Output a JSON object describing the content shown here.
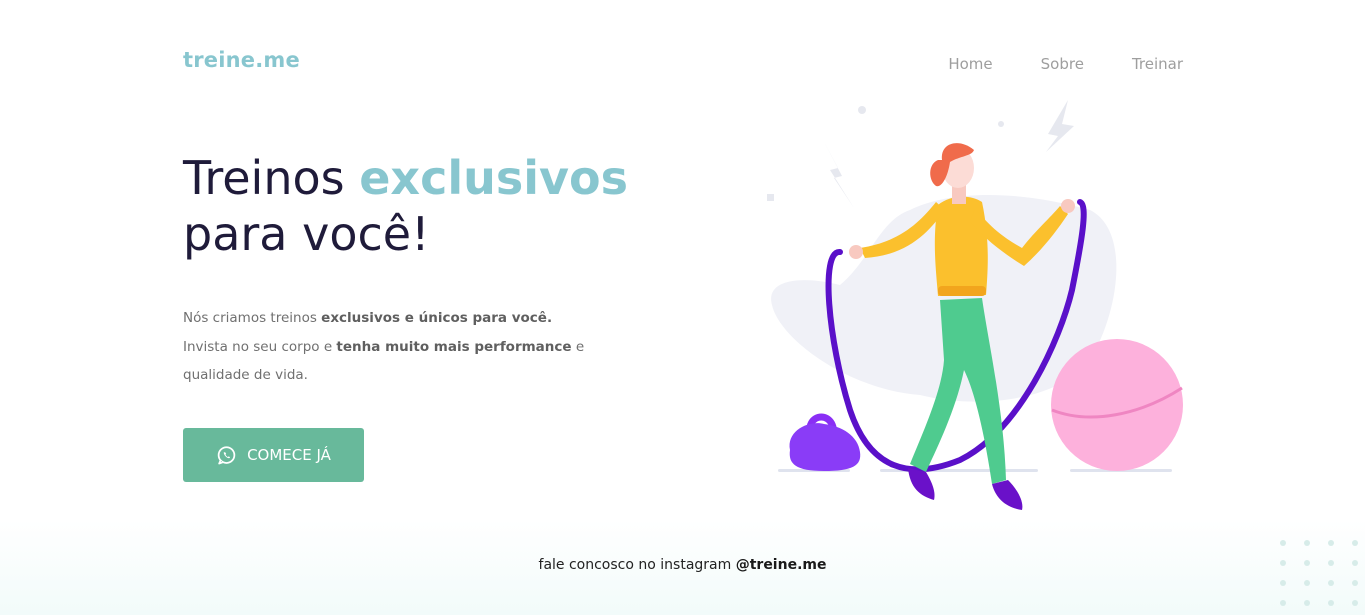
{
  "brand": {
    "name": "treine.me",
    "color": "#88c6cf"
  },
  "nav": {
    "items": [
      {
        "label": "Home"
      },
      {
        "label": "Sobre"
      },
      {
        "label": "Treinar"
      }
    ]
  },
  "hero": {
    "title_line1_prefix": "Treinos ",
    "title_line1_accent": "exclusivos",
    "title_line2": "para você!",
    "paragraph": {
      "p1": "Nós criamos treinos ",
      "p1_bold": "exclusivos e únicos para você.",
      "p2": "Invista no seu corpo e ",
      "p2_bold": "tenha muito mais performance",
      "p2_end": " e",
      "p3": "qualidade de vida."
    },
    "cta": {
      "label": "COMECE JÁ",
      "icon": "whatsapp-icon",
      "color": "#68b99b"
    }
  },
  "footer": {
    "text": "fale concosco no instagram ",
    "handle": "@treine.me"
  },
  "colors": {
    "heading": "#1f1b3a",
    "accent": "#88c6cf",
    "button": "#68b99b",
    "body_text": "#707070"
  }
}
